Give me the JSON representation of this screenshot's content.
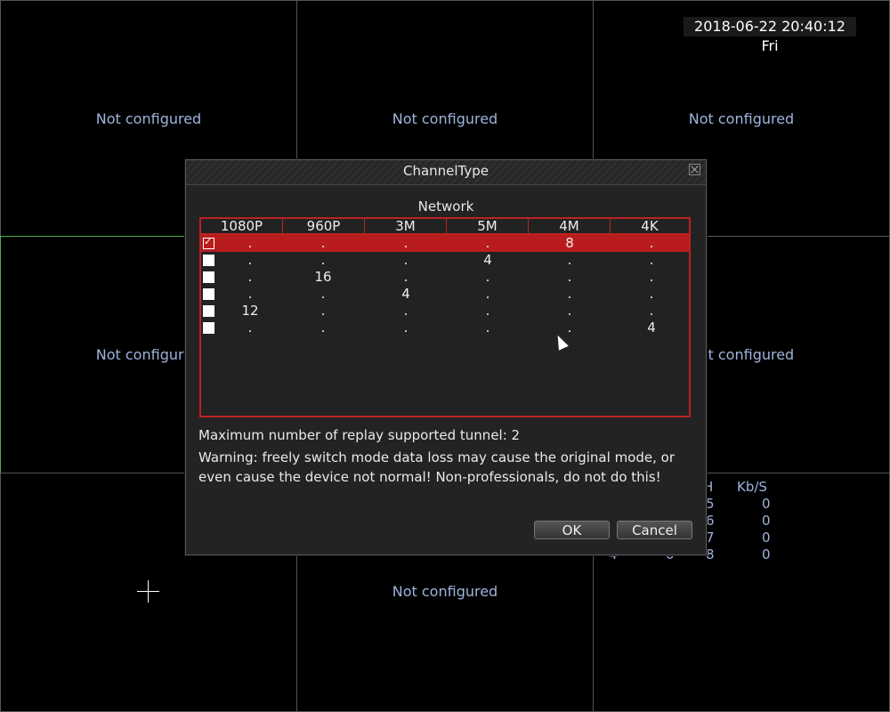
{
  "datetime": "2018-06-22 20:40:12 Fri",
  "cells": [
    {
      "label": "Not configured"
    },
    {
      "label": "Not configured"
    },
    {
      "label": "Not configured"
    },
    {
      "label": "Not configured"
    },
    {
      "label": "Not configured"
    },
    {
      "label": "Not configured"
    }
  ],
  "stats": {
    "headers": [
      "H",
      "Kb/S"
    ],
    "rows": [
      {
        "ch": "5",
        "kbs": "0"
      },
      {
        "ch": "6",
        "kbs": "0"
      },
      {
        "ch": "7",
        "kbs": "0"
      },
      {
        "a": "4",
        "b": "0",
        "ch": "8",
        "kbs": "0"
      }
    ]
  },
  "dialog": {
    "title": "ChannelType",
    "section": "Network",
    "columns": [
      "1080P",
      "960P",
      "3M",
      "5M",
      "4M",
      "4K"
    ],
    "rows": [
      {
        "selected": true,
        "values": [
          ".",
          ".",
          ".",
          ".",
          "8",
          "."
        ]
      },
      {
        "selected": false,
        "values": [
          ".",
          ".",
          ".",
          "4",
          ".",
          "."
        ]
      },
      {
        "selected": false,
        "values": [
          ".",
          "16",
          ".",
          ".",
          ".",
          "."
        ]
      },
      {
        "selected": false,
        "values": [
          ".",
          ".",
          "4",
          ".",
          ".",
          "."
        ]
      },
      {
        "selected": false,
        "values": [
          "12",
          ".",
          ".",
          ".",
          ".",
          "."
        ]
      },
      {
        "selected": false,
        "values": [
          ".",
          ".",
          ".",
          ".",
          ".",
          "4"
        ]
      }
    ],
    "replay_info": "Maximum number of replay supported tunnel: 2",
    "warning_line1": "Warning: freely switch mode data loss may cause the original mode, or",
    "warning_line2": "even cause the device not normal! Non-professionals, do not do this!",
    "ok_label": "OK",
    "cancel_label": "Cancel"
  }
}
